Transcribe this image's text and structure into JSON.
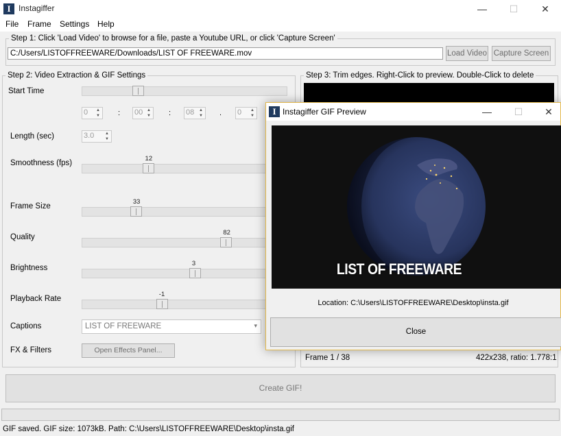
{
  "window": {
    "title": "Instagiffer",
    "icon_letter": "I",
    "minimize": "—",
    "maximize": "☐",
    "close": "✕"
  },
  "menu": [
    "File",
    "Frame",
    "Settings",
    "Help"
  ],
  "step1": {
    "legend": "Step 1: Click 'Load Video' to browse for a file, paste a Youtube URL, or click 'Capture Screen'",
    "path_value": "C:/Users/LISTOFFREEWARE/Downloads/LIST OF FREEWARE.mov",
    "load_video": "Load Video",
    "capture_screen": "Capture Screen"
  },
  "step2": {
    "legend": "Step 2: Video Extraction & GIF Settings",
    "start_time_label": "Start Time",
    "start_time": {
      "h": "0",
      "m": "00",
      "s": "08",
      "ms": "0",
      "sep1": ":",
      "sep2": ":",
      "sep3": "."
    },
    "start_time_fraction": 0.26,
    "length_label": "Length (sec)",
    "length_value": "3.0",
    "sliders": [
      {
        "label": "Smoothness (fps)",
        "value": "12",
        "fraction": 0.35
      },
      {
        "label": "Frame Size",
        "value": "33",
        "fraction": 0.28
      },
      {
        "label": "Quality",
        "value": "82",
        "fraction": 0.8
      },
      {
        "label": "Brightness",
        "value": "3",
        "fraction": 0.62
      },
      {
        "label": "Playback Rate",
        "value": "-1",
        "fraction": 0.43
      }
    ],
    "captions_label": "Captions",
    "captions_value": "LIST OF FREEWARE",
    "fx_label": "FX & Filters",
    "fx_button": "Open Effects Panel..."
  },
  "step3": {
    "legend": "Step 3: Trim edges. Right-Click to preview. Double-Click to delete",
    "frame_label": "Frame  1 / 38",
    "dimensions": "422x238, ratio: 1.778:1"
  },
  "preview": {
    "title": "Instagiffer GIF Preview",
    "caption": "LIST OF FREEWARE",
    "location": "Location: C:\\Users\\LISTOFFREEWARE\\Desktop\\insta.gif",
    "close_button": "Close"
  },
  "create_gif": "Create GIF!",
  "status": "GIF saved. GIF size: 1073kB. Path: C:\\Users\\LISTOFFREEWARE\\Desktop\\insta.gif",
  "colors": {
    "dialog_border": "#e3b84a",
    "app_icon": "#1f3a5f",
    "earth_ocean": "#2b3a6b"
  }
}
